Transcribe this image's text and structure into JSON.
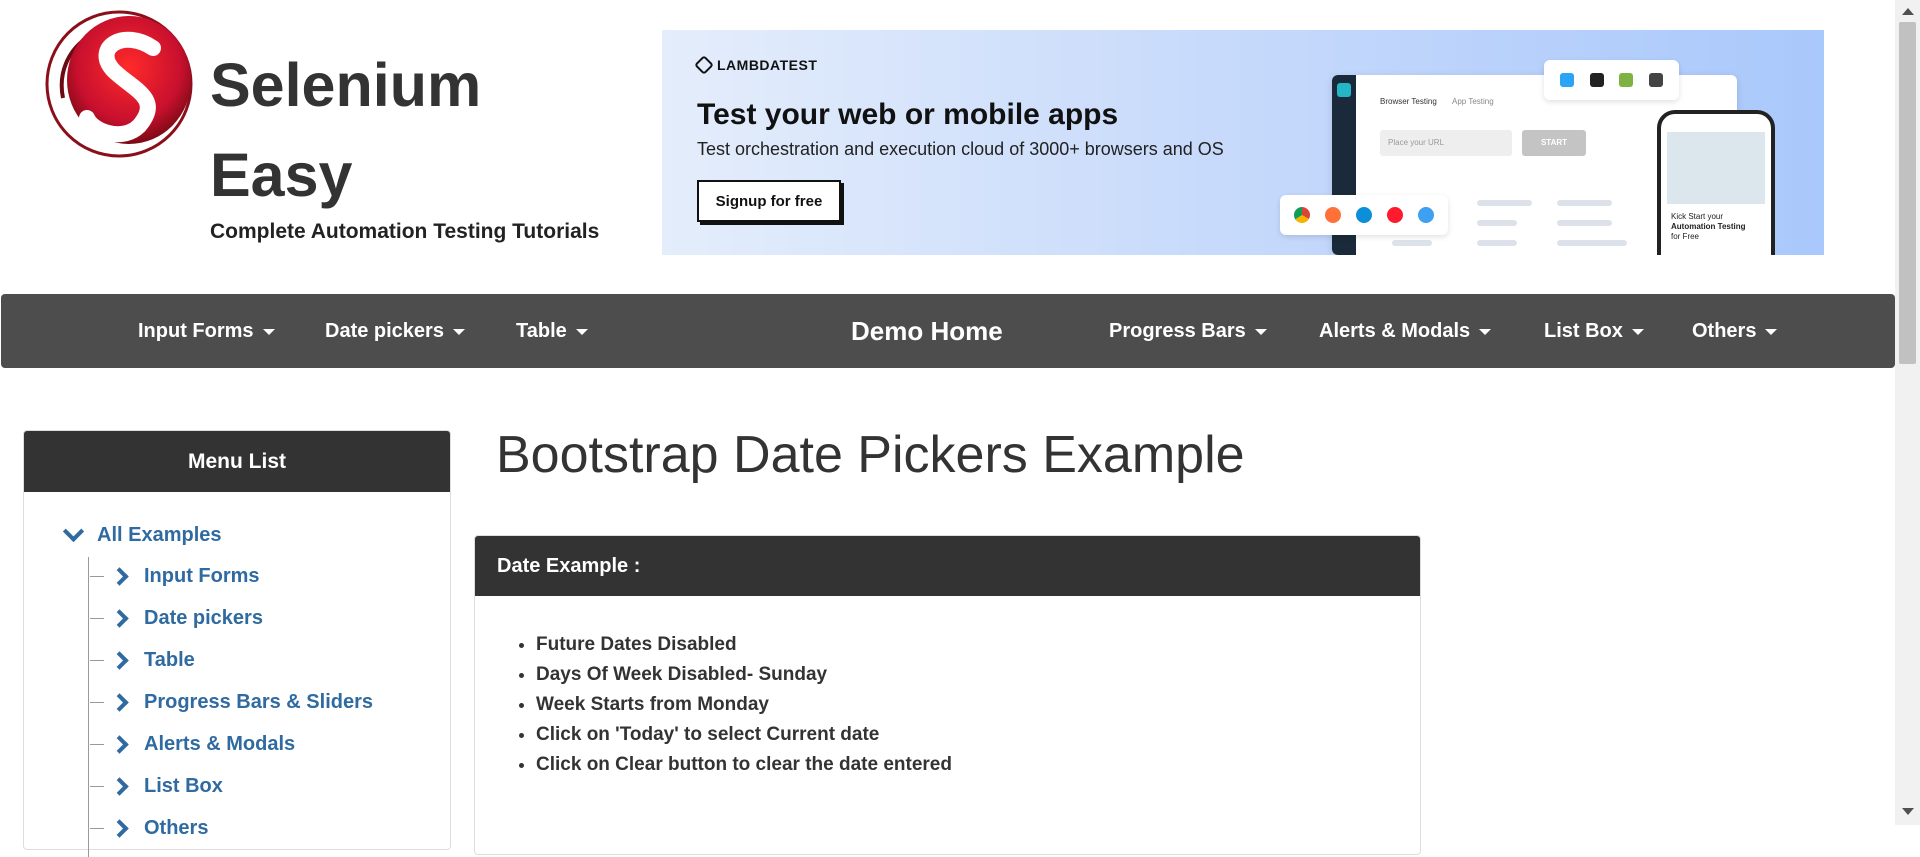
{
  "brand": {
    "title_line1": "Selenium",
    "title_line2": "Easy",
    "subtitle": "Complete Automation Testing Tutorials"
  },
  "ad": {
    "logo_text": "LAMBDATEST",
    "headline": "Test your web or mobile apps",
    "text": "Test orchestration and execution cloud of 3000+ browsers and OS",
    "button": "Signup for free",
    "tab1": "Browser Testing",
    "tab2": "App Testing",
    "url_placeholder": "Place your URL",
    "start": "START",
    "phone_line1": "Kick Start your",
    "phone_line2": "Automation Testing",
    "phone_line3": "for Free"
  },
  "nav": {
    "items_left": [
      "Input Forms",
      "Date pickers",
      "Table"
    ],
    "home": "Demo Home",
    "items_right": [
      "Progress Bars",
      "Alerts & Modals",
      "List Box",
      "Others"
    ]
  },
  "sidebar": {
    "title": "Menu List",
    "root": "All Examples",
    "items": [
      "Input Forms",
      "Date pickers",
      "Table",
      "Progress Bars & Sliders",
      "Alerts & Modals",
      "List Box",
      "Others"
    ]
  },
  "main": {
    "title": "Bootstrap Date Pickers Example",
    "panel_title": "Date Example :",
    "bullets": [
      "Future Dates Disabled",
      "Days Of Week Disabled- Sunday",
      "Week Starts from Monday",
      "Click on 'Today' to select Current date",
      "Click on Clear button to clear the date entered"
    ]
  },
  "colors": {
    "navbar": "#4d4d4d",
    "link": "#2f6aa0",
    "panel_header": "#333333",
    "logo_red": "#c8102e"
  }
}
